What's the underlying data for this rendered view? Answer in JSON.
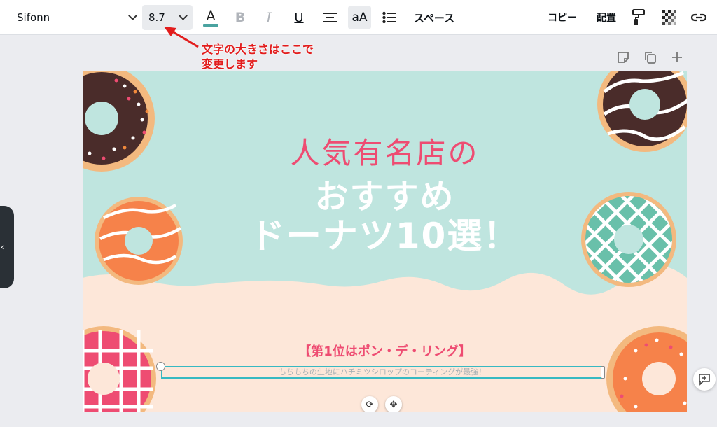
{
  "toolbar": {
    "font_name": "Sifonn",
    "font_size": "8.7",
    "text_color_icon": "A",
    "bold_icon": "B",
    "italic_icon": "I",
    "underline_icon": "U",
    "case_icon": "aA",
    "spacing_label": "スペース",
    "copy_label": "コピー",
    "position_label": "配置",
    "text_color": "#4aa3a0"
  },
  "annotation": {
    "line1": "文字の大きさはここで",
    "line2": "変更します",
    "color": "#e21c1c"
  },
  "canvas": {
    "title_line1": "人気有名店の",
    "title_line2": "おすすめ",
    "title_line3": "ドーナツ10選！",
    "rank_heading": "【第1位はポン・デ・リング】",
    "description": "もちもちの生地にハチミツシロップのコーティングが最強！",
    "bg_color": "#bfe5df",
    "accent_pink": "#ee4c72",
    "cream_color": "#fde7d9"
  }
}
